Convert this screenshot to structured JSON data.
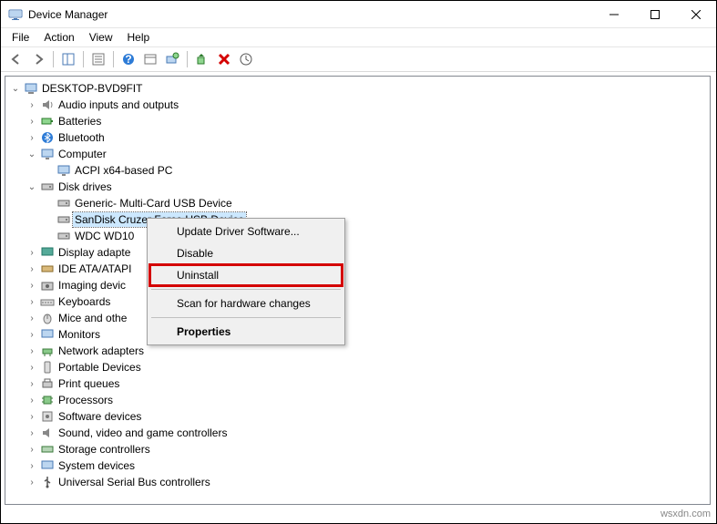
{
  "window": {
    "title": "Device Manager"
  },
  "menu": {
    "file": "File",
    "action": "Action",
    "view": "View",
    "help": "Help"
  },
  "tree": {
    "root": "DESKTOP-BVD9FIT",
    "audio": "Audio inputs and outputs",
    "batteries": "Batteries",
    "bluetooth": "Bluetooth",
    "computer": "Computer",
    "acpi": "ACPI x64-based PC",
    "diskdrives": "Disk drives",
    "disk_generic": "Generic- Multi-Card USB Device",
    "disk_sandisk": "SanDisk Cruzer Force USB Device",
    "disk_wdc": "WDC WD10",
    "display": "Display adapte",
    "ide": "IDE ATA/ATAPI",
    "imaging": "Imaging devic",
    "keyboards": "Keyboards",
    "mice": "Mice and othe",
    "monitors": "Monitors",
    "network": "Network adapters",
    "portable": "Portable Devices",
    "printq": "Print queues",
    "processors": "Processors",
    "software": "Software devices",
    "sound": "Sound, video and game controllers",
    "storage": "Storage controllers",
    "system": "System devices",
    "usb": "Universal Serial Bus controllers"
  },
  "context": {
    "update": "Update Driver Software...",
    "disable": "Disable",
    "uninstall": "Uninstall",
    "scan": "Scan for hardware changes",
    "properties": "Properties"
  },
  "watermark": "wsxdn.com"
}
